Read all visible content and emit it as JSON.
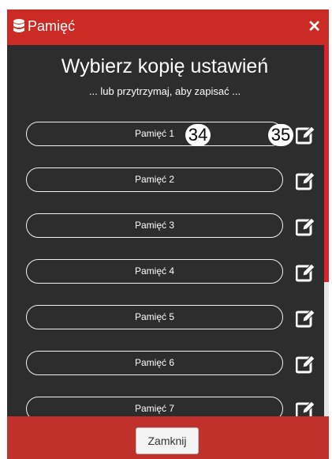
{
  "header": {
    "title": "Pamięć",
    "close_glyph": "✕",
    "accent_color": "#cc2b25"
  },
  "main": {
    "heading": "Wybierz kopię ustawień",
    "subheading": "... lub przytrzymaj, aby zapisać ..."
  },
  "slots": [
    {
      "label": "Pamięć 1"
    },
    {
      "label": "Pamięć 2"
    },
    {
      "label": "Pamięć 3"
    },
    {
      "label": "Pamięć 4"
    },
    {
      "label": "Pamięć 5"
    },
    {
      "label": "Pamięć 6"
    },
    {
      "label": "Pamięć 7"
    }
  ],
  "callouts": {
    "slot": "34",
    "edit": "35"
  },
  "footer": {
    "close_label": "Zamknij"
  },
  "icons": {
    "header": "database-icon",
    "edit": "edit-icon"
  }
}
